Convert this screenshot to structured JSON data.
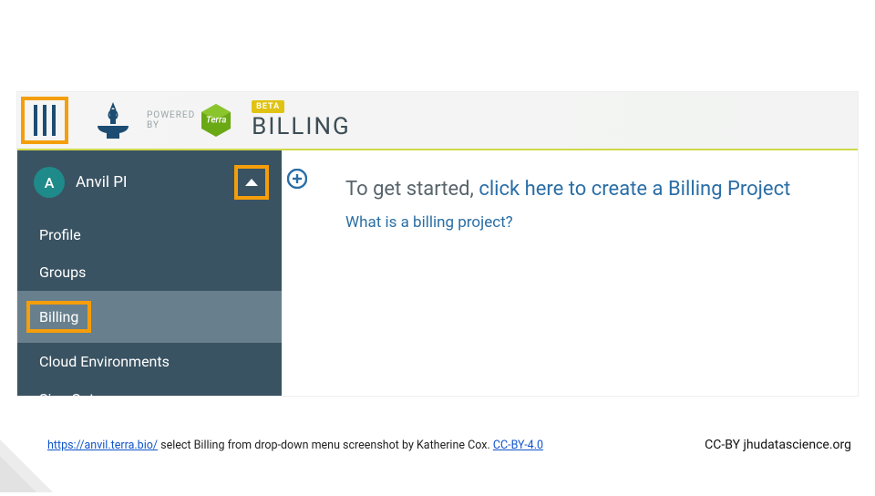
{
  "header": {
    "powered_by": "POWERED\nBY",
    "terra_label": "Terra",
    "beta_badge": "BETA",
    "page_title": "BILLING"
  },
  "sidebar": {
    "avatar_initial": "A",
    "user_name": "Anvil PI",
    "items": [
      {
        "label": "Profile"
      },
      {
        "label": "Groups"
      },
      {
        "label": "Billing"
      },
      {
        "label": "Cloud Environments"
      },
      {
        "label": "Sign Out"
      }
    ]
  },
  "main": {
    "get_started_prefix": "To get started, ",
    "get_started_link": "click here to create a Billing Project",
    "what_is_link": "What is a billing project?"
  },
  "footer": {
    "url_text": "https://anvil.terra.bio/",
    "caption_mid": " select Billing from drop-down menu screenshot by Katherine Cox.  ",
    "license_link": "CC-BY-4.0",
    "attribution": "CC-BY  jhudatascience.org"
  }
}
